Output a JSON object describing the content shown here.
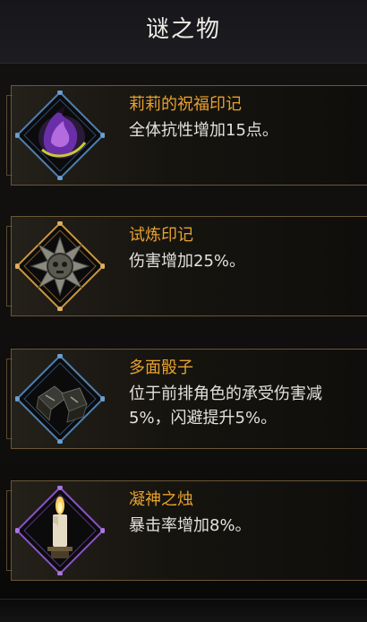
{
  "header": {
    "title": "谜之物"
  },
  "items": [
    {
      "name": "莉莉的祝福印记",
      "desc_lines": [
        "全体抗性增加15点。"
      ],
      "icon": "purple-flame-emblem-icon",
      "frame_color": "#4d7fb0"
    },
    {
      "name": "试炼印记",
      "desc_lines": [
        "伤害增加25%。"
      ],
      "icon": "spiked-skull-seal-icon",
      "frame_color": "#c8963e"
    },
    {
      "name": "多面骰子",
      "desc_lines": [
        "位于前排角色的承受伤害减",
        "5%，闪避提升5%。"
      ],
      "icon": "dice-icon",
      "frame_color": "#4d7fb0"
    },
    {
      "name": "凝神之烛",
      "desc_lines": [
        "暴击率增加8%。"
      ],
      "icon": "candle-icon",
      "frame_color": "#8a52c8"
    }
  ]
}
